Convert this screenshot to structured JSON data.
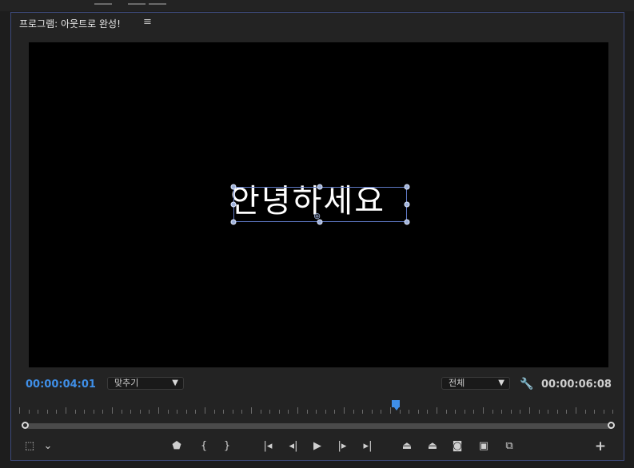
{
  "panel": {
    "title": "프로그램: 아웃트로 완성!",
    "menu_icon": "hamburger-menu-icon"
  },
  "viewer": {
    "title_text": "안녕하세요",
    "background": "#000000"
  },
  "timecode": {
    "current": "00:00:04:01",
    "duration": "00:00:06:08",
    "current_color": "#3f8fe8"
  },
  "zoom": {
    "selected": "맞추기"
  },
  "resolution": {
    "selected": "전체"
  },
  "settings_icon": "wrench-icon",
  "controls": {
    "left": [
      {
        "name": "safe-margins-icon",
        "glyph": "⬚"
      },
      {
        "name": "chevron-down-icon",
        "glyph": "⌄"
      }
    ],
    "center": [
      {
        "name": "add-marker-icon",
        "glyph": "⬟"
      },
      {
        "name": "mark-in-icon",
        "glyph": "{"
      },
      {
        "name": "mark-out-icon",
        "glyph": "}"
      },
      {
        "name": "go-to-in-icon",
        "glyph": "|◂"
      },
      {
        "name": "step-back-icon",
        "glyph": "◂|"
      },
      {
        "name": "play-icon",
        "glyph": "▶"
      },
      {
        "name": "step-forward-icon",
        "glyph": "|▸"
      },
      {
        "name": "go-to-out-icon",
        "glyph": "▸|"
      },
      {
        "name": "lift-icon",
        "glyph": "⏏"
      },
      {
        "name": "extract-icon",
        "glyph": "⏏"
      },
      {
        "name": "export-frame-icon",
        "glyph": "📷"
      },
      {
        "name": "comparison-view-icon",
        "glyph": "▣"
      },
      {
        "name": "proxy-toggle-icon",
        "glyph": "⧉"
      }
    ],
    "right": [
      {
        "name": "add-button-icon",
        "glyph": "+"
      }
    ]
  }
}
